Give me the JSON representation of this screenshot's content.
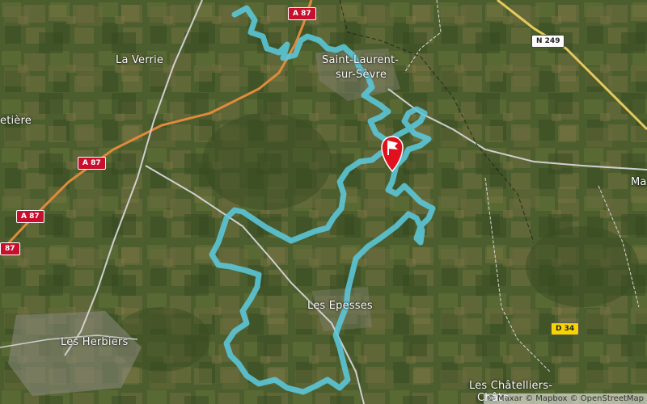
{
  "map": {
    "base_color": "#4a5a2c",
    "route_color": "#5bc8dc",
    "marker_color": "#e0101e",
    "places": [
      {
        "id": "la-verrie",
        "label": "La Verrie"
      },
      {
        "id": "saint-laurent-1",
        "label": "Saint-Laurent-"
      },
      {
        "id": "saint-laurent-2",
        "label": "sur-Sèvre"
      },
      {
        "id": "etiere",
        "label": "etière"
      },
      {
        "id": "les-epesses",
        "label": "Les Epesses"
      },
      {
        "id": "les-herbiers",
        "label": "Les Herbiers"
      },
      {
        "id": "les-chatelliers-1",
        "label": "Les Châtelliers-"
      },
      {
        "id": "les-chatelliers-2",
        "label": "Châte"
      },
      {
        "id": "ma",
        "label": "Ma"
      }
    ],
    "road_shields": [
      {
        "id": "a87-top",
        "label": "A 87",
        "kind": "a"
      },
      {
        "id": "a87-mid",
        "label": "A 87",
        "kind": "a"
      },
      {
        "id": "a87-left1",
        "label": "A 87",
        "kind": "a"
      },
      {
        "id": "a87-left2",
        "label": "87",
        "kind": "a"
      },
      {
        "id": "n249",
        "label": "N 249",
        "kind": "n"
      },
      {
        "id": "d34",
        "label": "D 34",
        "kind": "d"
      }
    ],
    "attribution": "© Maxar © Mapbox © OpenStreetMap"
  }
}
